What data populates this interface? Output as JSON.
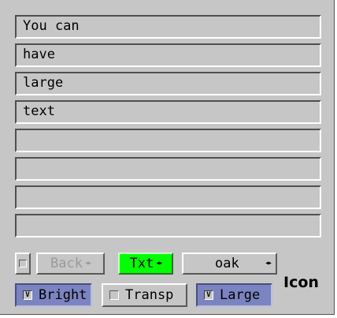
{
  "text_lines": [
    "You can",
    "have",
    "large",
    "text",
    "",
    "",
    "",
    ""
  ],
  "controls": {
    "back_label": "Back",
    "txt_label": "Txt",
    "oak_label": "oak",
    "arrows_glyph": "◂▸",
    "icon_label": "Icon",
    "bright_label": "Bright",
    "transp_label": "Transp",
    "large_label": "Large",
    "check_mark": "V"
  },
  "colors": {
    "panel": "#c6c6c6",
    "txt_button": "#00ff00",
    "toggle_active": "#7b84c0",
    "disabled_text": "#9a9a9a"
  },
  "states": {
    "bright": true,
    "transp": false,
    "large": true,
    "back_enabled": false
  }
}
